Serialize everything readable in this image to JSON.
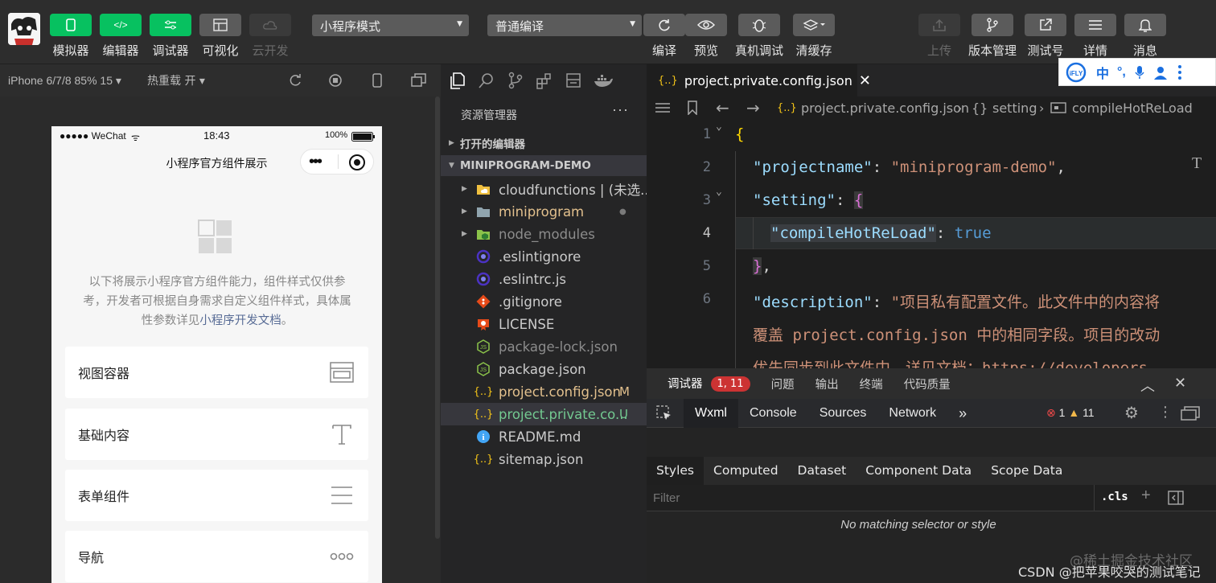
{
  "toolbar": {
    "simulator": "模拟器",
    "editor": "编辑器",
    "debugger": "调试器",
    "visualize": "可视化",
    "cloud_dev": "云开发",
    "mode_select": "小程序模式",
    "compile_select": "普通编译",
    "compile": "编译",
    "preview": "预览",
    "remote_debug": "真机调试",
    "clear_cache": "清缓存",
    "upload": "上传",
    "version_mgmt": "版本管理",
    "test_account": "测试号",
    "details": "详情",
    "messages": "消息"
  },
  "ifly": {
    "logo": "iFLY",
    "zh": "中"
  },
  "simulator_bar": {
    "device": "iPhone 6/7/8 85% 15",
    "hot_reload": "热重载 开"
  },
  "phone": {
    "carrier": "●●●●● WeChat",
    "time": "18:43",
    "battery": "100%",
    "title": "小程序官方组件展示",
    "intro_text": "以下将展示小程序官方组件能力，组件样式仅供参考，开发者可根据自身需求自定义组件样式，具体属性参数详见",
    "intro_link": "小程序开发文档",
    "intro_end": "。",
    "cards": [
      "视图容器",
      "基础内容",
      "表单组件",
      "导航"
    ]
  },
  "explorer": {
    "title": "资源管理器",
    "more": "···",
    "open_editors": "打开的编辑器",
    "project": "MINIPROGRAM-DEMO",
    "files": [
      {
        "name": "cloudfunctions | (未选...",
        "badge": ""
      },
      {
        "name": "miniprogram",
        "badge": "●"
      },
      {
        "name": "node_modules",
        "badge": ""
      },
      {
        "name": ".eslintignore",
        "badge": ""
      },
      {
        "name": ".eslintrc.js",
        "badge": ""
      },
      {
        "name": ".gitignore",
        "badge": ""
      },
      {
        "name": "LICENSE",
        "badge": ""
      },
      {
        "name": "package-lock.json",
        "badge": ""
      },
      {
        "name": "package.json",
        "badge": ""
      },
      {
        "name": "project.config.json",
        "badge": "M"
      },
      {
        "name": "project.private.co...",
        "badge": "U"
      },
      {
        "name": "README.md",
        "badge": ""
      },
      {
        "name": "sitemap.json",
        "badge": ""
      }
    ]
  },
  "editor": {
    "tab": "project.private.config.json",
    "crumb_file": "project.private.config.json",
    "crumb_setting": "setting",
    "crumb_key": "compileHotReLoad",
    "lines": [
      "1",
      "2",
      "3",
      "4",
      "5",
      "6"
    ],
    "code": {
      "l1": "{",
      "l2_key": "\"projectname\"",
      "l2_val": "\"miniprogram-demo\"",
      "l3_key": "\"setting\"",
      "l3_brace": "{",
      "l4_key": "\"compileHotReLoad\"",
      "l4_val": "true",
      "l5": "}",
      "l6_key": "\"description\"",
      "l6_val": "\"项目私有配置文件。此文件中的内容将",
      "l7_val": "覆盖 project.config.json 中的相同字段。项目的改动",
      "l8_val": "优先同步到此文件中，详见文档：https://developers"
    }
  },
  "debugger": {
    "tab_debugger": "调试器",
    "badge": "1, 11",
    "issues": "问题",
    "output": "输出",
    "terminal": "终端",
    "code_quality": "代码质量",
    "tools": [
      "Wxml",
      "Console",
      "Sources",
      "Network"
    ],
    "errors": "1",
    "warnings": "11",
    "subtabs": [
      "Styles",
      "Computed",
      "Dataset",
      "Component Data",
      "Scope Data"
    ],
    "filter_placeholder": "Filter",
    "cls": ".cls",
    "no_match": "No matching selector or style"
  },
  "watermark": {
    "line1": "@稀土掘金技术社区",
    "line2": "CSDN @把苹果咬哭的测试笔记"
  }
}
